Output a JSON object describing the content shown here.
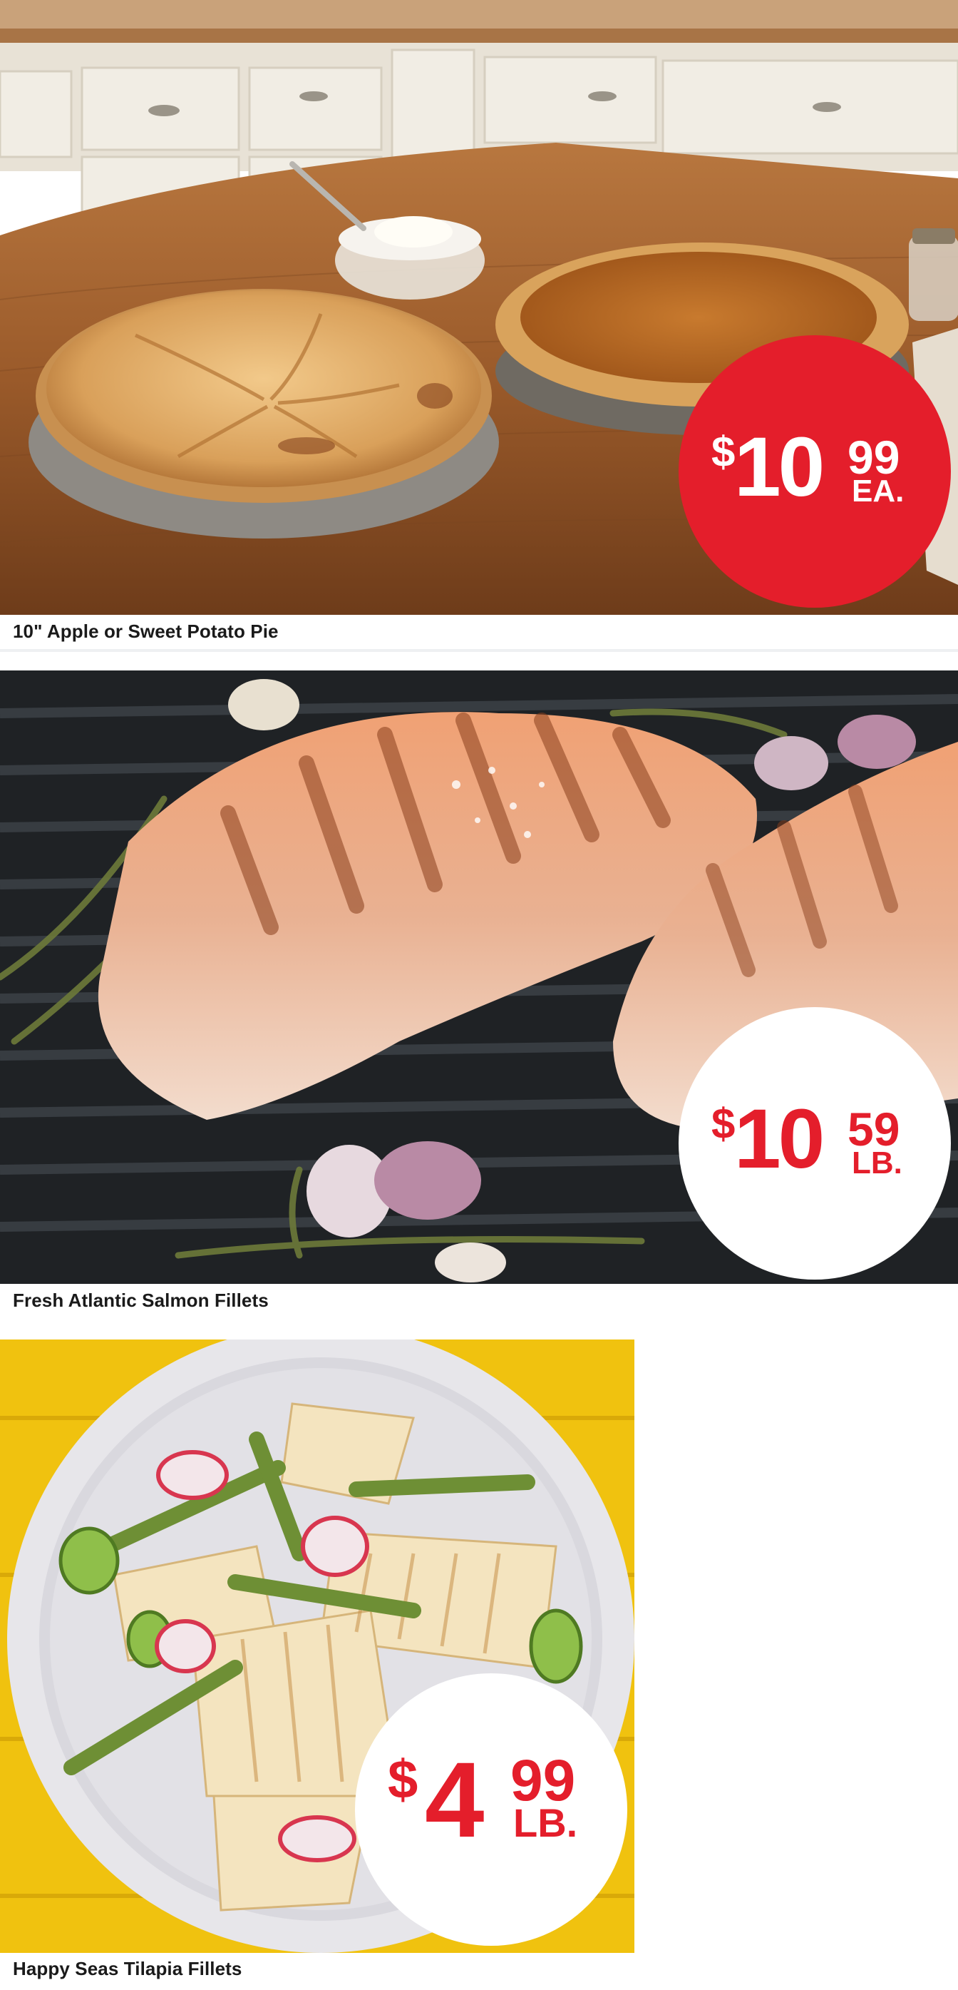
{
  "products": [
    {
      "name": "10\" Apple or Sweet Potato Pie",
      "price": {
        "currency": "$",
        "dollars": "10",
        "cents": "99",
        "unit": "EA."
      },
      "badge_style": "red",
      "image": "apple-and-sweet-potato-pies-photo"
    },
    {
      "name": "Fresh Atlantic Salmon Fillets",
      "price": {
        "currency": "$",
        "dollars": "10",
        "cents": "59",
        "unit": "LB."
      },
      "badge_style": "white",
      "image": "grilled-salmon-fillets-photo"
    },
    {
      "name": "Happy Seas Tilapia Fillets",
      "price": {
        "currency": "$",
        "dollars": "4",
        "cents": "99",
        "unit": "LB."
      },
      "badge_style": "white",
      "image": "tilapia-plate-photo"
    }
  ],
  "colors": {
    "price_red": "#e41e2b",
    "caption_text": "#1a1a1a",
    "background": "#ffffff"
  }
}
